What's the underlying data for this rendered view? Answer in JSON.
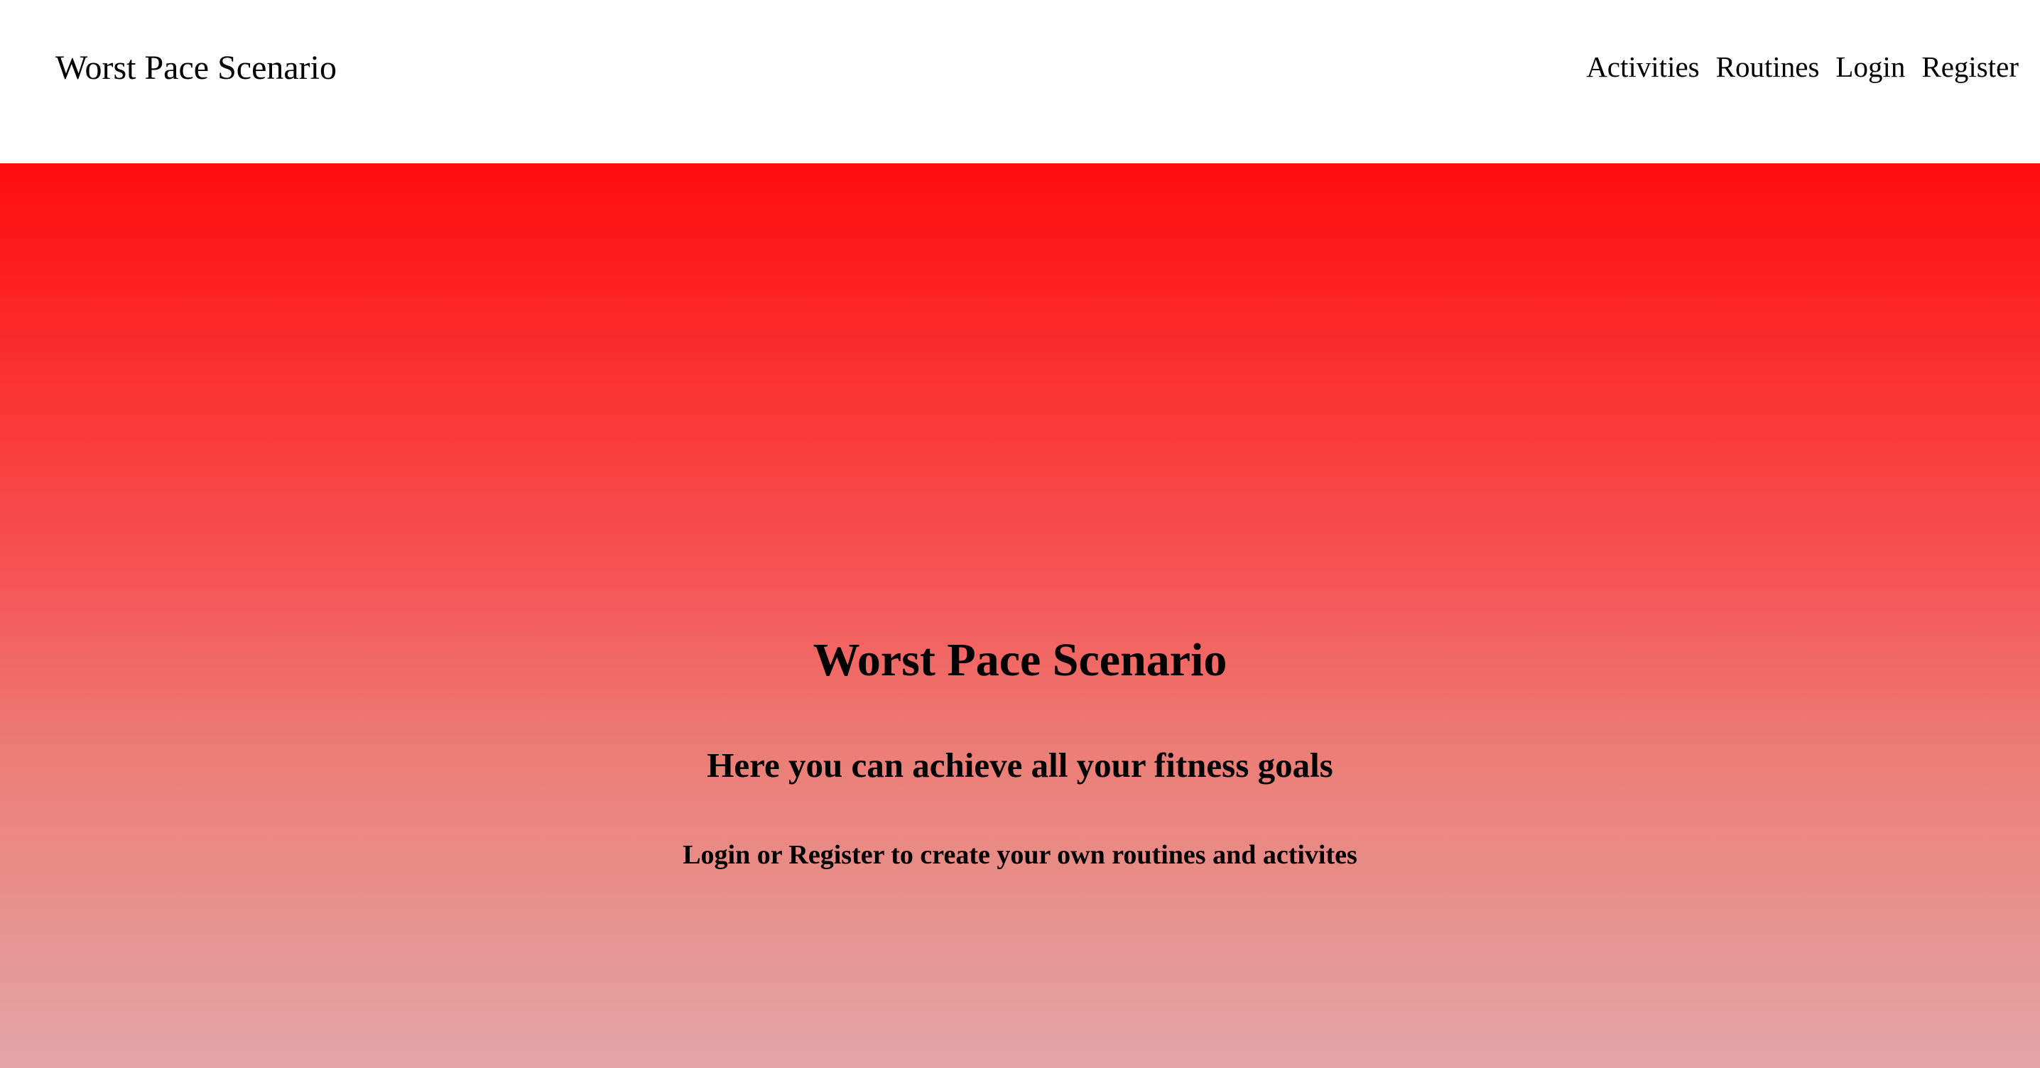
{
  "header": {
    "brand": "Worst Pace Scenario",
    "nav": [
      {
        "label": "Activities"
      },
      {
        "label": "Routines"
      },
      {
        "label": "Login"
      },
      {
        "label": "Register"
      }
    ]
  },
  "hero": {
    "title": "Worst Pace Scenario",
    "subtitle": "Here you can achieve all your fitness goals",
    "cta_text": "Login or Register to create your own routines and activites",
    "gradient_top_color": "#ff0c0c",
    "gradient_bottom_color": "#e2a6a6"
  }
}
